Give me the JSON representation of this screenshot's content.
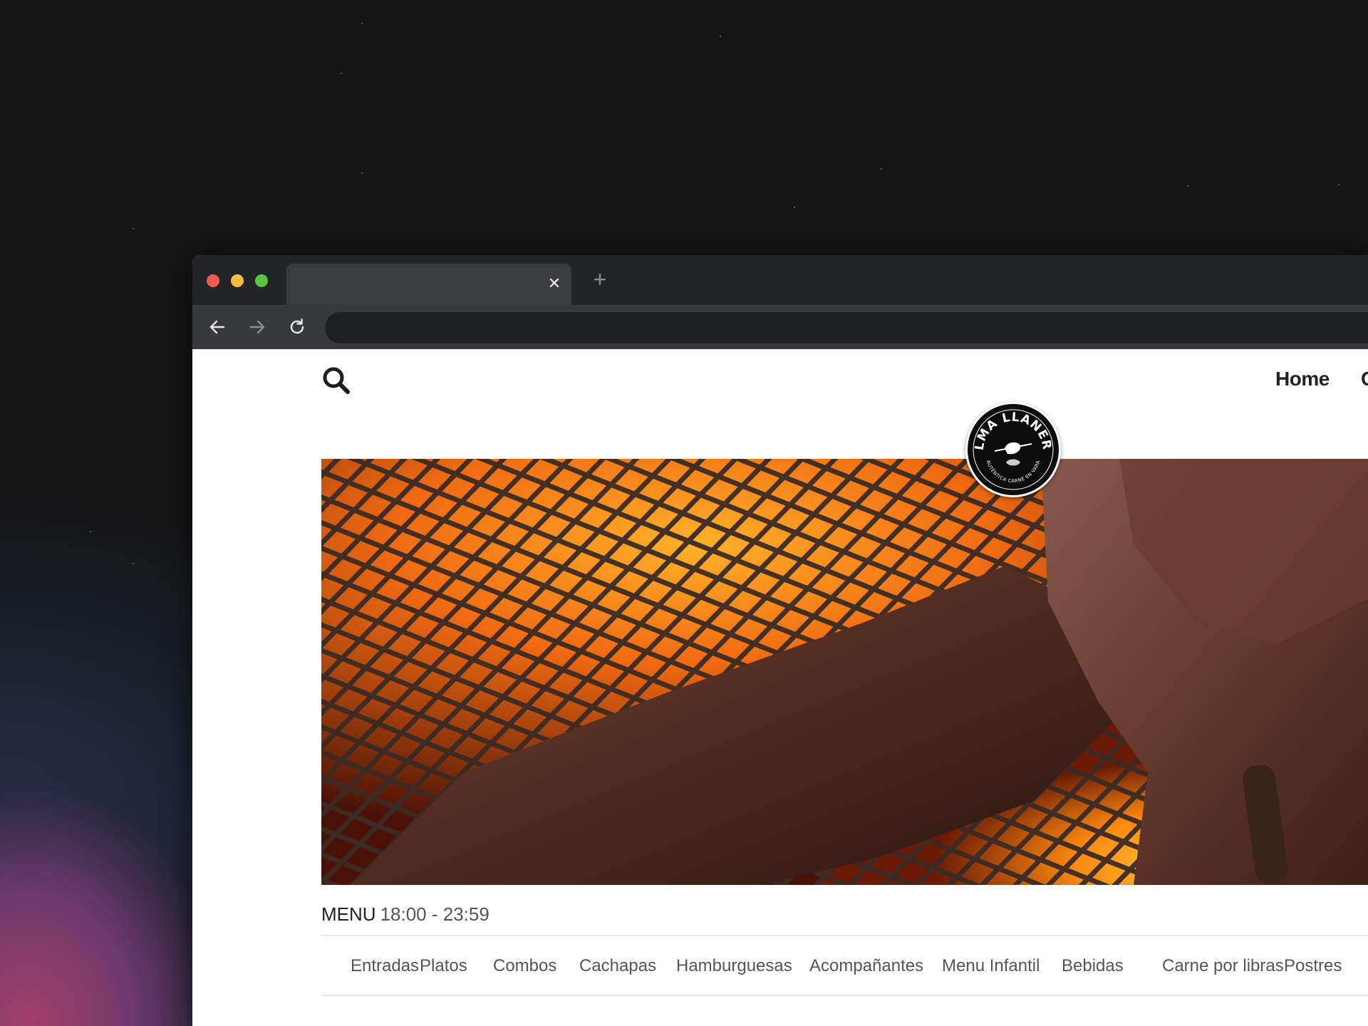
{
  "browser": {
    "tab": {
      "title": "",
      "close_icon": "close-icon"
    },
    "new_tab_icon": "plus-icon",
    "address_bar": {
      "value": ""
    },
    "nav": {
      "back_icon": "arrow-left-icon",
      "forward_icon": "arrow-right-icon",
      "reload_icon": "reload-icon"
    }
  },
  "site": {
    "search_icon": "search-icon",
    "nav": {
      "home_label": "Home",
      "next_label_partial": "C"
    },
    "logo": {
      "name": "ALMA LLANERA",
      "tagline": "AUTÉNTICA CARNE EN VARA"
    },
    "menu": {
      "title": "MENU",
      "hours": "18:00 - 23:59",
      "categories": [
        "Entradas",
        "Platos",
        "Combos",
        "Cachapas",
        "Hamburguesas",
        "Acompañantes",
        "Menu Infantil",
        "Bebidas",
        "Carne por libras",
        "Postres"
      ]
    }
  },
  "colors": {
    "desktop_bg": "#151516",
    "tabbar_bg": "#232425",
    "toolbar_bg": "#38393b",
    "traffic_red": "#ee5b53",
    "traffic_yellow": "#f5bd3d",
    "traffic_green": "#5cc540"
  }
}
